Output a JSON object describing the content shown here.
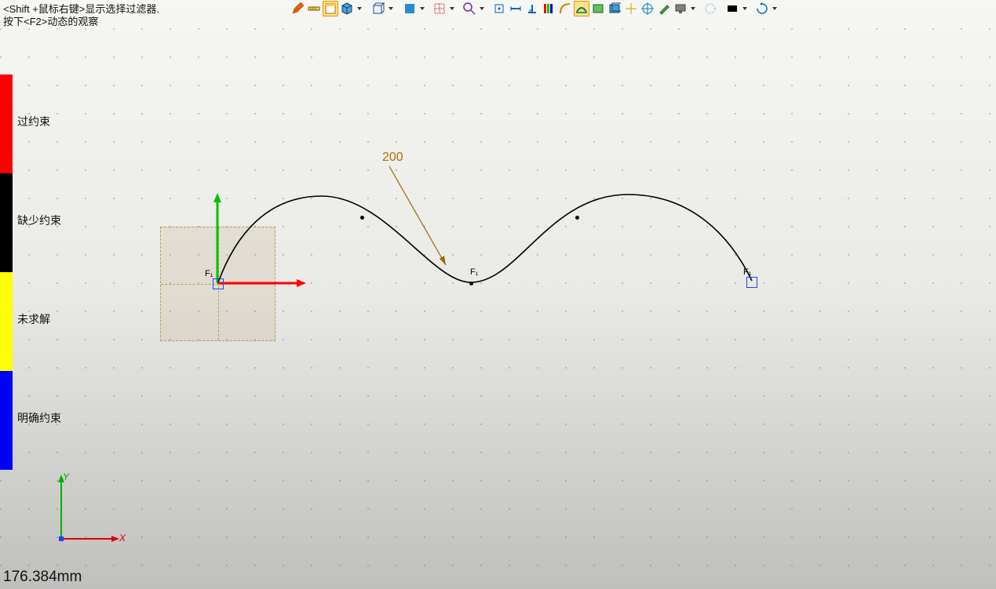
{
  "hints": {
    "line1": "<Shift +鼠标右键>显示选择过滤器.",
    "line2": "按下<F2>动态的观察"
  },
  "legend": {
    "over": "过约束",
    "under": "缺少约束",
    "unsolved": "未求解",
    "well": "明确约束"
  },
  "dimension": {
    "radius": "200"
  },
  "triad": {
    "x": "X",
    "y": "Y"
  },
  "status": {
    "measurement": "176.384mm"
  },
  "markers": {
    "f1": "F₁"
  }
}
